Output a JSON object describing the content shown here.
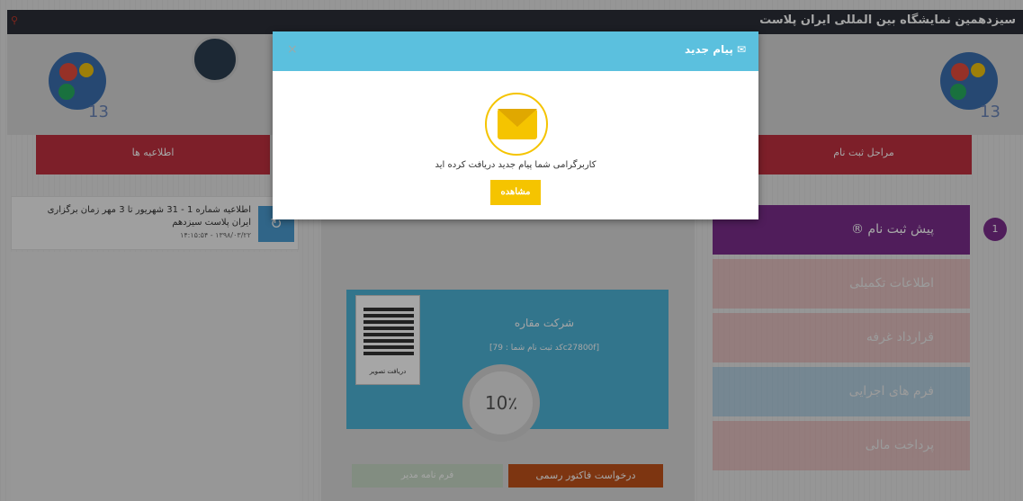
{
  "header": {
    "title": "سیزدهمین نمایشگاه بین المللی ایران پلاست"
  },
  "ribbons": {
    "announcements": "اطلاعیه ها",
    "registration_steps": "مراحل ثبت نام"
  },
  "news": {
    "text": "اطلاعیه شماره 1 - 31 شهریور تا 3 مهر زمان برگزاری ایران پلاست سیزدهم",
    "date": "۱۳۹۸/۰۳/۲۲ - ۱۴:۱۵:۵۴"
  },
  "company": {
    "name": "شرکت مقاره",
    "code": "[کد ثبت نام شما : 79c27800f]",
    "qr_label": "دریافت تصویر",
    "progress": "10٪"
  },
  "buttons": {
    "pre_invoice": "فرم نامه مدیر",
    "official_invoice": "درخواست فاکتور رسمی"
  },
  "steps": {
    "active": "® پیش ثبت نام",
    "number": "1",
    "s2": "اطلاعات تکمیلی",
    "s3": "قرارداد غرفه",
    "s4": "فرم های اجرایی",
    "s5": "پرداخت مالی"
  },
  "modal": {
    "title": "پیام جدید",
    "message": "کاربرگرامی شما پیام جدید دریافت کرده اید",
    "button": "مشاهده",
    "close": "×"
  }
}
